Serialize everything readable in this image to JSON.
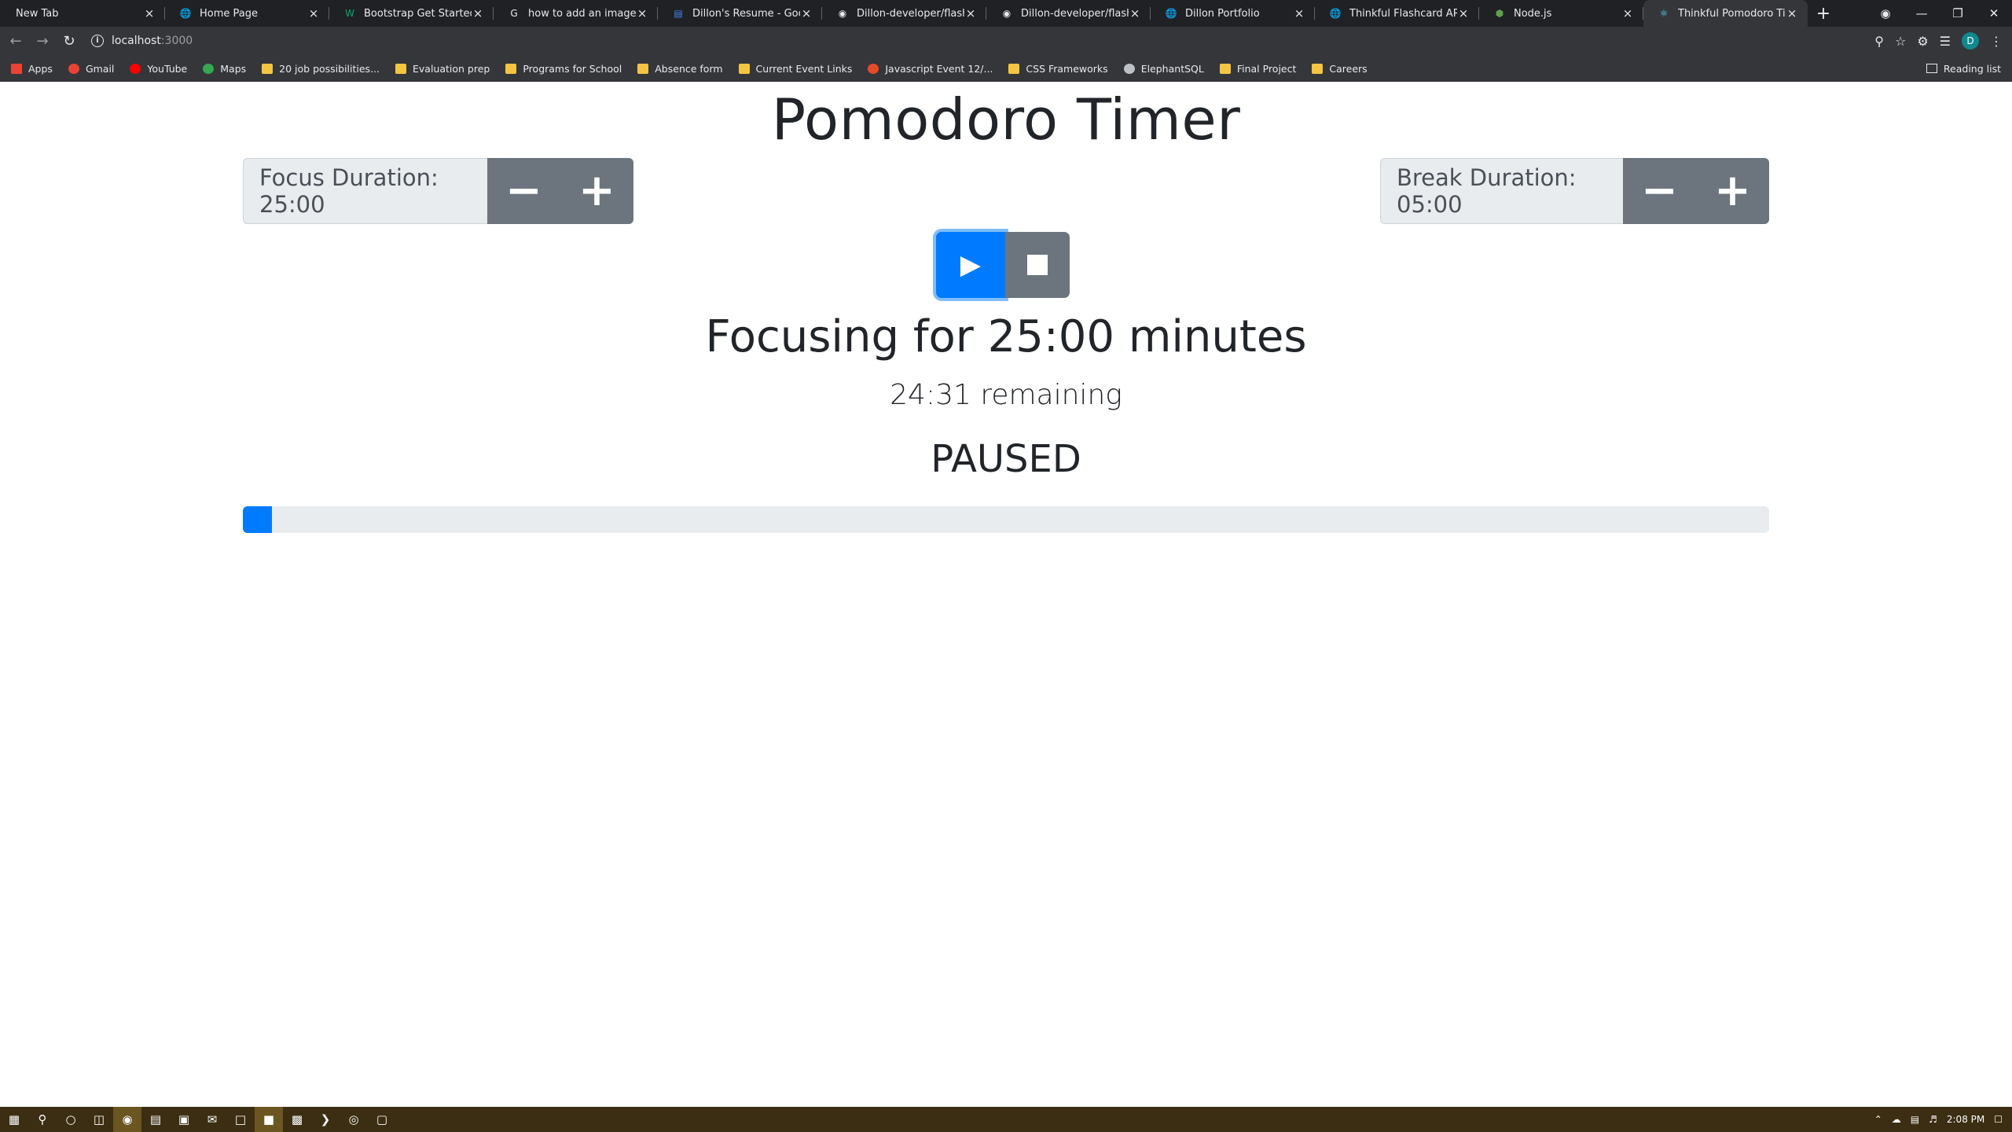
{
  "browser": {
    "tabs": [
      {
        "title": "New Tab",
        "icon": "new-tab-icon"
      },
      {
        "title": "Home Page",
        "icon": "globe-icon"
      },
      {
        "title": "Bootstrap Get Started",
        "icon": "w3schools-icon"
      },
      {
        "title": "how to add an image file to",
        "icon": "google-icon"
      },
      {
        "title": "Dillon's Resume - Google D",
        "icon": "google-docs-icon"
      },
      {
        "title": "Dillon-developer/flashcard",
        "icon": "github-icon"
      },
      {
        "title": "Dillon-developer/flashcard",
        "icon": "github-icon"
      },
      {
        "title": "Dillon Portfolio",
        "icon": "globe-icon"
      },
      {
        "title": "Thinkful Flashcard API",
        "icon": "globe-icon"
      },
      {
        "title": "Node.js",
        "icon": "nodejs-icon"
      },
      {
        "title": "Thinkful Pomodoro Timer",
        "icon": "react-icon"
      }
    ],
    "address": {
      "host": "localhost",
      "port": ":3000"
    },
    "bookmarks": [
      {
        "label": "Apps",
        "icon": "apps-grid-icon"
      },
      {
        "label": "Gmail",
        "icon": "gmail-icon"
      },
      {
        "label": "YouTube",
        "icon": "youtube-icon"
      },
      {
        "label": "Maps",
        "icon": "maps-icon"
      },
      {
        "label": "20 job possibilities...",
        "icon": "folder-icon"
      },
      {
        "label": "Evaluation prep",
        "icon": "folder-icon"
      },
      {
        "label": "Programs for School",
        "icon": "folder-icon"
      },
      {
        "label": "Absence form",
        "icon": "folder-icon"
      },
      {
        "label": "Current Event Links",
        "icon": "folder-icon"
      },
      {
        "label": "Javascript Event 12/...",
        "icon": "codepen-icon"
      },
      {
        "label": "CSS Frameworks",
        "icon": "folder-icon"
      },
      {
        "label": "ElephantSQL",
        "icon": "elephant-icon"
      },
      {
        "label": "Final Project",
        "icon": "folder-icon"
      },
      {
        "label": "Careers",
        "icon": "folder-icon"
      }
    ],
    "reading_list": "Reading list",
    "profile_initial": "D"
  },
  "app": {
    "title": "Pomodoro Timer",
    "focus": {
      "label": "Focus Duration: 25:00",
      "decrease": "−",
      "increase": "+"
    },
    "break": {
      "label": "Break Duration: 05:00",
      "decrease": "−",
      "increase": "+"
    },
    "session_heading": "Focusing for 25:00 minutes",
    "remaining": "24:31 remaining",
    "status": "PAUSED",
    "progress_percent": 1.9,
    "colors": {
      "primary": "#007bff",
      "secondary": "#6c757d",
      "track": "#e9ecef"
    }
  },
  "taskbar": {
    "time": "2:08 PM"
  }
}
